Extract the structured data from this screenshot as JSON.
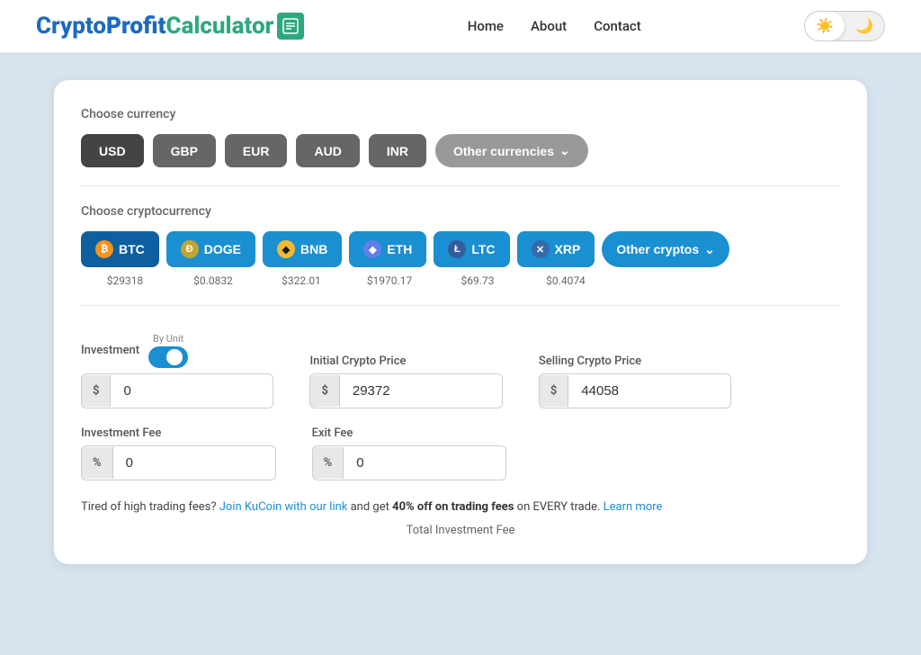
{
  "header": {
    "logo": {
      "crypto": "Crypto",
      "profit": "Profit",
      "calculator": "Calculator",
      "icon": "⊞"
    },
    "nav": [
      {
        "label": "Home",
        "href": "#"
      },
      {
        "label": "About",
        "href": "#"
      },
      {
        "label": "Contact",
        "href": "#"
      }
    ],
    "theme": {
      "light_icon": "☀",
      "dark_icon": "🌙"
    }
  },
  "currency_section": {
    "label": "Choose currency",
    "buttons": [
      {
        "id": "usd",
        "label": "USD",
        "active": true
      },
      {
        "id": "gbp",
        "label": "GBP",
        "active": false
      },
      {
        "id": "eur",
        "label": "EUR",
        "active": false
      },
      {
        "id": "aud",
        "label": "AUD",
        "active": false
      },
      {
        "id": "inr",
        "label": "INR",
        "active": false
      },
      {
        "id": "other",
        "label": "Other currencies",
        "active": false,
        "is_dropdown": true
      }
    ]
  },
  "crypto_section": {
    "label": "Choose cryptocurrency",
    "cryptos": [
      {
        "id": "btc",
        "label": "BTC",
        "icon": "₿",
        "price": "$29318",
        "selected": true
      },
      {
        "id": "doge",
        "label": "DOGE",
        "icon": "D",
        "price": "$0.0832",
        "selected": false
      },
      {
        "id": "bnb",
        "label": "BNB",
        "icon": "◆",
        "price": "$322.01",
        "selected": false
      },
      {
        "id": "eth",
        "label": "ETH",
        "icon": "◆",
        "price": "$1970.17",
        "selected": false
      },
      {
        "id": "ltc",
        "label": "LTC",
        "icon": "Ł",
        "price": "$69.73",
        "selected": false
      },
      {
        "id": "xrp",
        "label": "XRP",
        "icon": "✕",
        "price": "$0.4074",
        "selected": false
      }
    ],
    "other_label": "Other cryptos"
  },
  "form": {
    "investment": {
      "label": "Investment",
      "prefix": "$",
      "value": "0",
      "toggle_label": "By Unit"
    },
    "initial_price": {
      "label": "Initial Crypto Price",
      "prefix": "$",
      "value": "29372"
    },
    "selling_price": {
      "label": "Selling Crypto Price",
      "prefix": "$",
      "value": "44058"
    },
    "investment_fee": {
      "label": "Investment Fee",
      "prefix": "%",
      "value": "0"
    },
    "exit_fee": {
      "label": "Exit Fee",
      "prefix": "%",
      "value": "0"
    }
  },
  "promo": {
    "text_before": "Tired of high trading fees?",
    "link1_text": "Join KuCoin with our link",
    "link1_href": "#",
    "text_middle": "and get",
    "bold_text": "40% off on trading fees",
    "text_after": "on EVERY trade.",
    "link2_text": "Learn more",
    "link2_href": "#"
  },
  "total_fee_label": "Total Investment Fee"
}
